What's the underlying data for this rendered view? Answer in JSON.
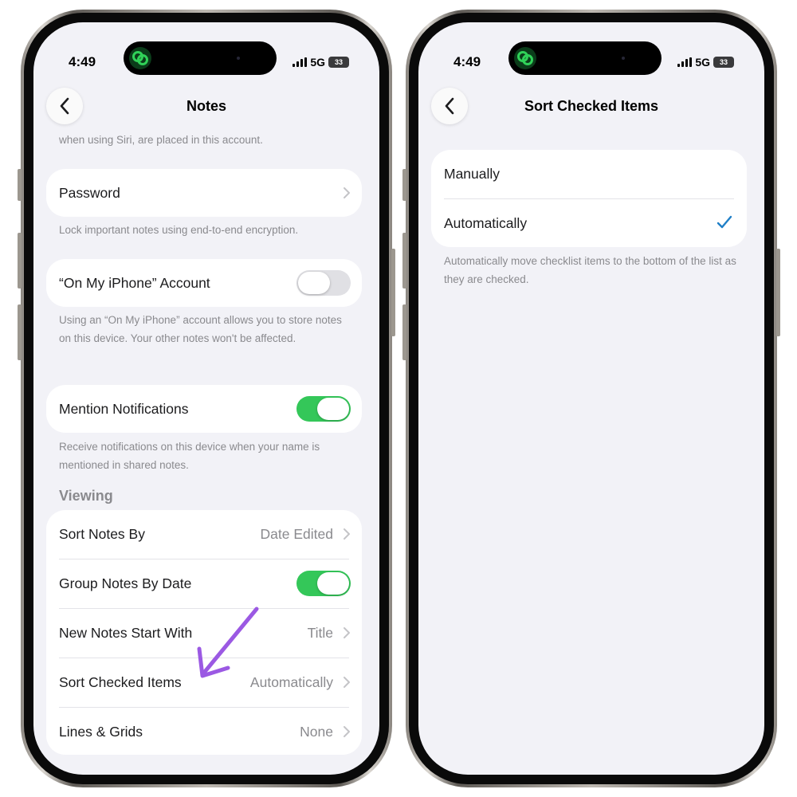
{
  "status_bar": {
    "time": "4:49",
    "network": "5G",
    "battery": "33"
  },
  "left": {
    "title": "Notes",
    "top_footnote": "when using Siri, are placed in this account.",
    "password": {
      "label": "Password",
      "footnote": "Lock important notes using end-to-end encryption."
    },
    "on_my_iphone": {
      "label": "“On My iPhone” Account",
      "toggle_on": false,
      "footnote": "Using an “On My iPhone” account allows you to store notes on this device. Your other notes won't be affected."
    },
    "mentions": {
      "label": "Mention Notifications",
      "toggle_on": true,
      "footnote": "Receive notifications on this device when your name is mentioned in shared notes."
    },
    "viewing": {
      "header": "Viewing",
      "rows": [
        {
          "label": "Sort Notes By",
          "value": "Date Edited"
        },
        {
          "label": "Group Notes By Date",
          "toggle_on": true
        },
        {
          "label": "New Notes Start With",
          "value": "Title"
        },
        {
          "label": "Sort Checked Items",
          "value": "Automatically"
        },
        {
          "label": "Lines & Grids",
          "value": "None"
        }
      ]
    }
  },
  "right": {
    "title": "Sort Checked Items",
    "options": [
      {
        "label": "Manually",
        "selected": false
      },
      {
        "label": "Automatically",
        "selected": true
      }
    ],
    "footnote": "Automatically move checklist items to the bottom of the list as they are checked."
  },
  "colors": {
    "toggle_on": "#34c759",
    "checkmark": "#1f7fc7",
    "annotation_arrow": "#9b59e3",
    "app_icon": "#30d158"
  },
  "icons": [
    "back-chevron-icon",
    "chevron-right-icon",
    "checkmark-icon",
    "app-link-icon",
    "signal-icon",
    "battery-icon",
    "annotation-arrow-icon"
  ]
}
